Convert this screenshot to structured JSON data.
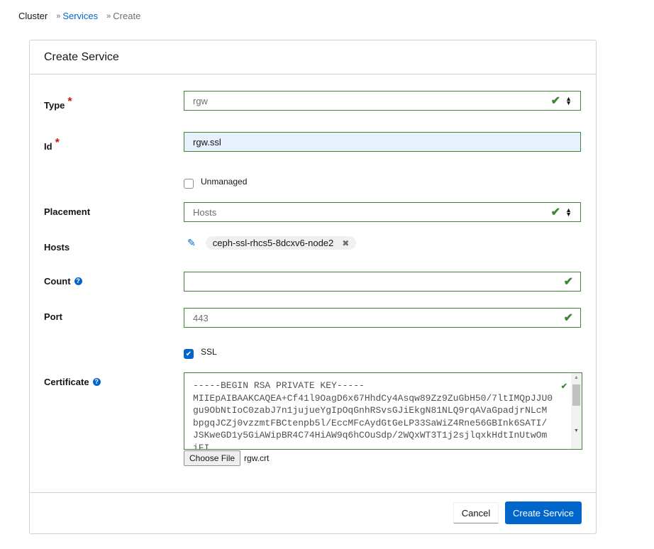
{
  "breadcrumb": {
    "items": [
      "Cluster",
      "Services",
      "Create"
    ],
    "separator": "»"
  },
  "card": {
    "title": "Create Service"
  },
  "form": {
    "type": {
      "label": "Type",
      "required_mark": "*",
      "value": "rgw"
    },
    "id": {
      "label": "Id",
      "required_mark": "*",
      "value": "rgw.ssl"
    },
    "unmanaged": {
      "label": "Unmanaged",
      "checked": false
    },
    "placement": {
      "label": "Placement",
      "value": "Hosts"
    },
    "hosts": {
      "label": "Hosts",
      "chips": [
        "ceph-ssl-rhcs5-8dcxv6-node2"
      ],
      "remove_glyph": "✖",
      "edit_glyph": "✎"
    },
    "count": {
      "label": "Count",
      "value": ""
    },
    "port": {
      "label": "Port",
      "value": "443"
    },
    "ssl": {
      "label": "SSL",
      "checked": true
    },
    "certificate": {
      "label": "Certificate",
      "value": "-----BEGIN RSA PRIVATE KEY-----\nMIIEpAIBAAKCAQEA+Cf41l9OagD6x67HhdCy4Asqw89Zz9ZuGbH50/7ltIMQpJJU0\ngu9ObNtIoC0zabJ7n1jujueYgIpOqGnhRSvsGJiEkgN81NLQ9rqAVaGpadjrNLcM\nbpgqJCZj0vzzmtFBCtenpb5l/EccMFcAydGtGeLP33SaWiZ4Rne56GBInk6SATI/\nJSKweGD1y5GiAWipBR4C74HiAW9q6hCOuSdp/2WQxWT3T1j2sjlqxkHdtInUtwOm\niFI..."
    },
    "file": {
      "button": "Choose File",
      "filename": "rgw.crt"
    }
  },
  "icons": {
    "check": "✔",
    "help": "?",
    "checkbox_check": "✔"
  },
  "footer": {
    "cancel": "Cancel",
    "submit": "Create Service"
  },
  "colors": {
    "primary": "#0066cc",
    "success": "#3e8635",
    "required": "#c9190b"
  }
}
